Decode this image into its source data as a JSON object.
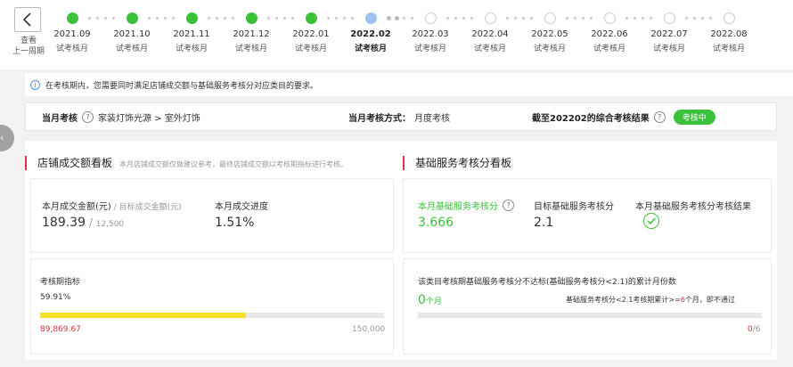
{
  "timeline": {
    "back_label_1": "查看",
    "back_label_2": "上一周期",
    "nodes": [
      {
        "month": "2021.09",
        "label": "试考核月"
      },
      {
        "month": "2021.10",
        "label": "试考核月"
      },
      {
        "month": "2021.11",
        "label": "试考核月"
      },
      {
        "month": "2021.12",
        "label": "试考核月"
      },
      {
        "month": "2022.01",
        "label": "试考核月"
      },
      {
        "month": "2022.02",
        "label": "试考核月"
      },
      {
        "month": "2022.03",
        "label": "试考核月"
      },
      {
        "month": "2022.04",
        "label": "试考核月"
      },
      {
        "month": "2022.05",
        "label": "试考核月"
      },
      {
        "month": "2022.06",
        "label": "试考核月"
      },
      {
        "month": "2022.07",
        "label": "试考核月"
      },
      {
        "month": "2022.08",
        "label": "试考核月"
      }
    ]
  },
  "notice": {
    "icon": "i",
    "text": "在考核期内，您需要同时满足店铺成交额与基础服务考核分对应类目的要求。"
  },
  "summary": {
    "month_exam_label": "当月考核",
    "category_path": "家装灯饰光源 > 室外灯饰",
    "method_label": "当月考核方式：",
    "method_value": "月度考核",
    "result_label": "截至202202的综合考核结果",
    "result_status": "考核中"
  },
  "shop_board": {
    "title": "店铺成交额看板",
    "subtitle": "本月店铺成交额仅做建议参考，最终店铺成交额以考核期指标进行考核。",
    "monthly_amount_label": "本月成交金额(元)",
    "target_amount_label": " / 目标成交金额(元)",
    "monthly_amount": "189.39",
    "target_amount_sep": " / ",
    "target_amount": "12,500",
    "progress_label": "本月成交进度",
    "progress_value": "1.51%",
    "period_label": "考核期指标",
    "period_percent": "59.91%",
    "period_fill": 0.5991,
    "period_current": "89,869.67",
    "period_target": "150,000"
  },
  "service_board": {
    "title": "基础服务考核分看板",
    "score_label": "本月基础服务考核分",
    "score_value": "3.666",
    "target_label": "目标基础服务考核分",
    "target_value": "2.1",
    "result_label": "本月基础服务考核分考核结果",
    "below_label": "该类目考核期基础服务考核分不达标(基础服务考核分<2.1)的累计月份数",
    "months_count": "0",
    "months_unit": "个月",
    "rule_prefix": "基础服务考核分<2.1考核期累计>=",
    "rule_months": "6",
    "rule_suffix": "个月，即不通过",
    "count_current": "0",
    "count_total": "/6"
  },
  "colors": {
    "done": "#3cc13b",
    "current": "#9ec2f0",
    "accent_red": "#d9363e",
    "progress": "#f6e22b"
  }
}
